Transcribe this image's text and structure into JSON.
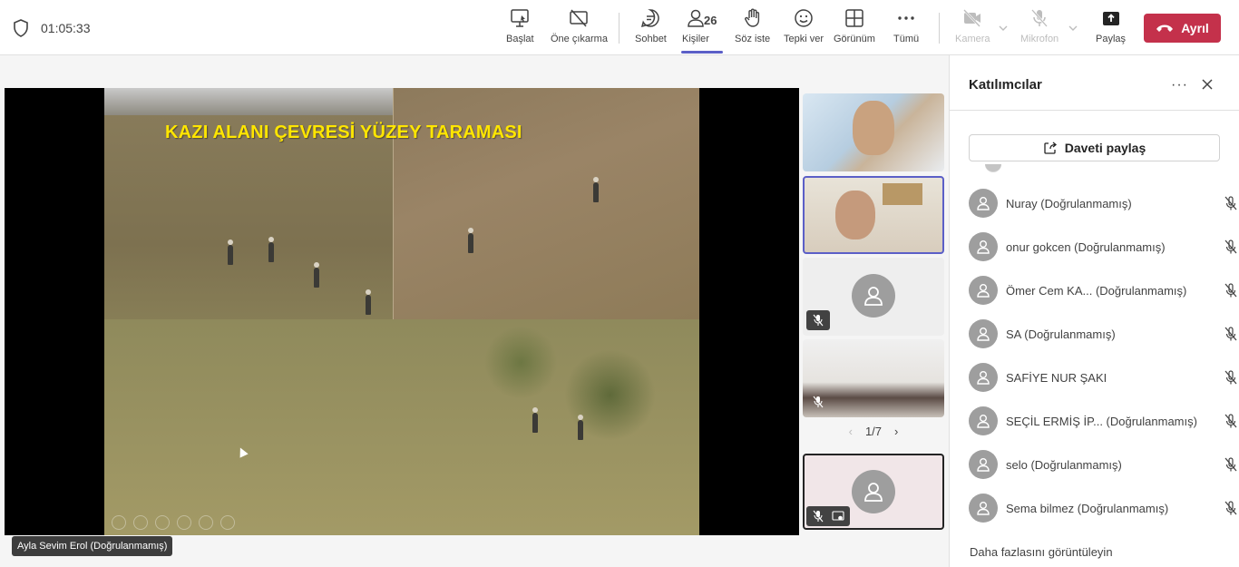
{
  "meeting": {
    "timer": "01:05:33"
  },
  "toolbar": {
    "start_label": "Başlat",
    "spotlight_label": "Öne çıkarma",
    "chat_label": "Sohbet",
    "people_label": "Kişiler",
    "people_count": "26",
    "raise_hand_label": "Söz iste",
    "react_label": "Tepki ver",
    "view_label": "Görünüm",
    "more_label": "Tümü",
    "camera_label": "Kamera",
    "mic_label": "Mikrofon",
    "share_label": "Paylaş",
    "leave_label": "Ayrıl"
  },
  "stage": {
    "slide_title": "KAZI ALANI ÇEVRESİ YÜZEY TARAMASI",
    "presenter_name": "Ayla Sevim Erol (Doğrulanmamış)"
  },
  "gallery": {
    "page_indicator": "1/7"
  },
  "panel": {
    "title": "Katılımcılar",
    "invite_label": "Daveti paylaş",
    "participants": [
      {
        "name": "Nuray (Doğrulanmamış)"
      },
      {
        "name": "onur gokcen (Doğrulanmamış)"
      },
      {
        "name": "Ömer Cem KA...  (Doğrulanmamış)"
      },
      {
        "name": "SA (Doğrulanmamış)"
      },
      {
        "name": "SAFİYE NUR ŞAKI"
      },
      {
        "name": "SEÇİL ERMİŞ İP...  (Doğrulanmamış)"
      },
      {
        "name": "selo (Doğrulanmamış)"
      },
      {
        "name": "Sema bilmez (Doğrulanmamış)"
      }
    ],
    "more_label": "Daha fazlasını görüntüleyin"
  },
  "colors": {
    "accent": "#5b5fc7",
    "leave": "#c4314b",
    "slide_title": "#ffe600"
  }
}
